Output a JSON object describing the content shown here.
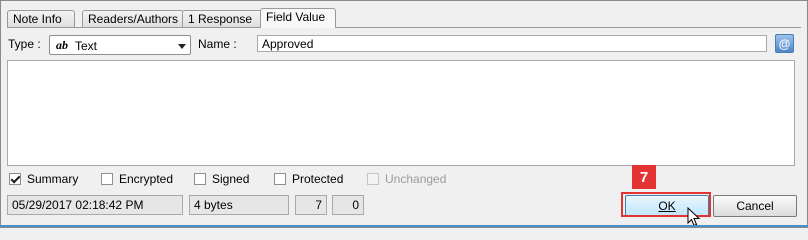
{
  "tabs": [
    {
      "label": "Note Info"
    },
    {
      "label": "Readers/Authors"
    },
    {
      "label": "1  Response"
    },
    {
      "label": "Field Value",
      "active": true
    }
  ],
  "type_label": "Type :",
  "type_select": {
    "icon": "ab",
    "value": "Text"
  },
  "name_label": "Name :",
  "name_value": "Approved",
  "at_button": "@",
  "checkboxes": [
    {
      "label": "Summary",
      "checked": true
    },
    {
      "label": "Encrypted",
      "checked": false
    },
    {
      "label": "Signed",
      "checked": false
    },
    {
      "label": "Protected",
      "checked": false
    },
    {
      "label": "Unchanged",
      "checked": false,
      "disabled": true
    }
  ],
  "status": {
    "date": "05/29/2017 02:18:42 PM",
    "size": "4 bytes",
    "n1": "7",
    "n2": "0"
  },
  "buttons": {
    "ok": "OK",
    "cancel": "Cancel"
  },
  "callout": {
    "number": "7",
    "color": "#e33333"
  }
}
